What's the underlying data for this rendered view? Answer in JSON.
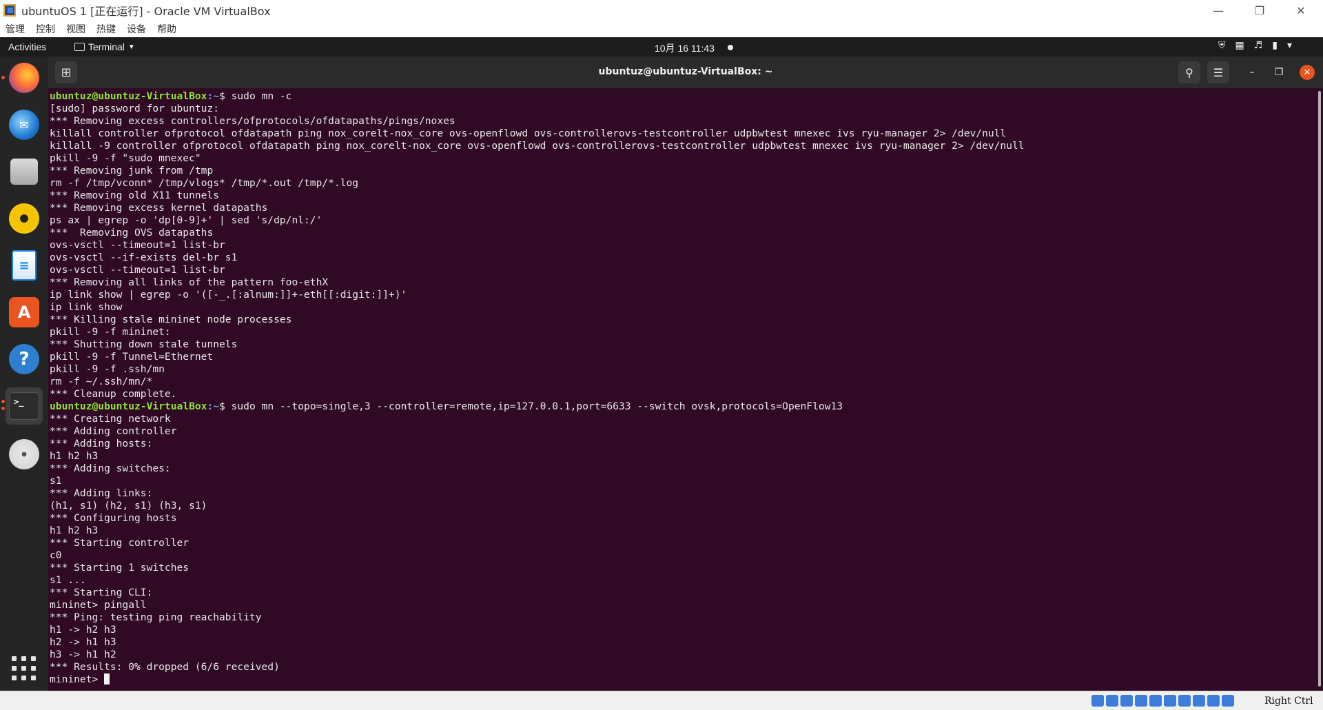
{
  "vbox": {
    "title": "ubuntuOS 1 [正在运行] - Oracle VM VirtualBox",
    "menu": [
      "管理",
      "控制",
      "视图",
      "热键",
      "设备",
      "帮助"
    ],
    "host_key": "Right Ctrl",
    "status_icons": [
      "hard-disk-icon",
      "optical-drive-icon",
      "audio-icon",
      "network-icon",
      "usb-icon",
      "shared-folders-icon",
      "display-icon",
      "video-capture-icon",
      "mouse-integration-icon",
      "arrow-down-icon"
    ]
  },
  "gnome": {
    "activities": "Activities",
    "app_menu": "Terminal",
    "clock": "10月 16  11:43"
  },
  "dock": [
    {
      "name": "firefox",
      "icon": "firefox-icon",
      "running": true,
      "color": "#e66000"
    },
    {
      "name": "thunderbird",
      "icon": "thunderbird-icon",
      "running": false,
      "color": "#1f78d1"
    },
    {
      "name": "files",
      "icon": "files-icon",
      "running": false,
      "color": "#b5b5b5"
    },
    {
      "name": "rhythmbox",
      "icon": "rhythmbox-icon",
      "running": false,
      "color": "#f5c400"
    },
    {
      "name": "libreoffice-writer",
      "icon": "writer-icon",
      "running": false,
      "color": "#1e88e5"
    },
    {
      "name": "ubuntu-software",
      "icon": "software-icon",
      "running": false,
      "color": "#e95420"
    },
    {
      "name": "help",
      "icon": "help-icon",
      "running": false,
      "color": "#2f7fd1"
    },
    {
      "name": "terminal",
      "icon": "terminal-icon",
      "running": true,
      "color": "#2c2c2c"
    },
    {
      "name": "dvd",
      "icon": "dvd-icon",
      "running": false,
      "color": "#e8e8e8"
    }
  ],
  "terminal": {
    "title": "ubuntuz@ubuntuz-VirtualBox: ~",
    "prompt_user": "ubuntuz@ubuntuz-VirtualBox",
    "prompt_path": ":~",
    "prompt_symbol": "$ ",
    "lines": [
      {
        "type": "prompt",
        "text": "sudo mn -c"
      },
      {
        "type": "out",
        "text": "[sudo] password for ubuntuz:"
      },
      {
        "type": "out",
        "text": "*** Removing excess controllers/ofprotocols/ofdatapaths/pings/noxes"
      },
      {
        "type": "out",
        "text": "killall controller ofprotocol ofdatapath ping nox_corelt-nox_core ovs-openflowd ovs-controllerovs-testcontroller udpbwtest mnexec ivs ryu-manager 2> /dev/null"
      },
      {
        "type": "out",
        "text": "killall -9 controller ofprotocol ofdatapath ping nox_corelt-nox_core ovs-openflowd ovs-controllerovs-testcontroller udpbwtest mnexec ivs ryu-manager 2> /dev/null"
      },
      {
        "type": "out",
        "text": "pkill -9 -f \"sudo mnexec\""
      },
      {
        "type": "out",
        "text": "*** Removing junk from /tmp"
      },
      {
        "type": "out",
        "text": "rm -f /tmp/vconn* /tmp/vlogs* /tmp/*.out /tmp/*.log"
      },
      {
        "type": "out",
        "text": "*** Removing old X11 tunnels"
      },
      {
        "type": "out",
        "text": "*** Removing excess kernel datapaths"
      },
      {
        "type": "out",
        "text": "ps ax | egrep -o 'dp[0-9]+' | sed 's/dp/nl:/'"
      },
      {
        "type": "out",
        "text": "***  Removing OVS datapaths"
      },
      {
        "type": "out",
        "text": "ovs-vsctl --timeout=1 list-br"
      },
      {
        "type": "out",
        "text": "ovs-vsctl --if-exists del-br s1"
      },
      {
        "type": "out",
        "text": "ovs-vsctl --timeout=1 list-br"
      },
      {
        "type": "out",
        "text": "*** Removing all links of the pattern foo-ethX"
      },
      {
        "type": "out",
        "text": "ip link show | egrep -o '([-_.[:alnum:]]+-eth[[:digit:]]+)'"
      },
      {
        "type": "out",
        "text": "ip link show"
      },
      {
        "type": "out",
        "text": "*** Killing stale mininet node processes"
      },
      {
        "type": "out",
        "text": "pkill -9 -f mininet:"
      },
      {
        "type": "out",
        "text": "*** Shutting down stale tunnels"
      },
      {
        "type": "out",
        "text": "pkill -9 -f Tunnel=Ethernet"
      },
      {
        "type": "out",
        "text": "pkill -9 -f .ssh/mn"
      },
      {
        "type": "out",
        "text": "rm -f ~/.ssh/mn/*"
      },
      {
        "type": "out",
        "text": "*** Cleanup complete."
      },
      {
        "type": "prompt",
        "text": "sudo mn --topo=single,3 --controller=remote,ip=127.0.0.1,port=6633 --switch ovsk,protocols=OpenFlow13"
      },
      {
        "type": "out",
        "text": "*** Creating network"
      },
      {
        "type": "out",
        "text": "*** Adding controller"
      },
      {
        "type": "out",
        "text": "*** Adding hosts:"
      },
      {
        "type": "out",
        "text": "h1 h2 h3"
      },
      {
        "type": "out",
        "text": "*** Adding switches:"
      },
      {
        "type": "out",
        "text": "s1"
      },
      {
        "type": "out",
        "text": "*** Adding links:"
      },
      {
        "type": "out",
        "text": "(h1, s1) (h2, s1) (h3, s1)"
      },
      {
        "type": "out",
        "text": "*** Configuring hosts"
      },
      {
        "type": "out",
        "text": "h1 h2 h3"
      },
      {
        "type": "out",
        "text": "*** Starting controller"
      },
      {
        "type": "out",
        "text": "c0"
      },
      {
        "type": "out",
        "text": "*** Starting 1 switches"
      },
      {
        "type": "out",
        "text": "s1 ..."
      },
      {
        "type": "out",
        "text": "*** Starting CLI:"
      },
      {
        "type": "out",
        "text": "mininet> pingall"
      },
      {
        "type": "out",
        "text": "*** Ping: testing ping reachability"
      },
      {
        "type": "out",
        "text": "h1 -> h2 h3"
      },
      {
        "type": "out",
        "text": "h2 -> h1 h3"
      },
      {
        "type": "out",
        "text": "h3 -> h1 h2"
      },
      {
        "type": "out",
        "text": "*** Results: 0% dropped (6/6 received)"
      },
      {
        "type": "cursor",
        "text": "mininet> "
      }
    ]
  }
}
